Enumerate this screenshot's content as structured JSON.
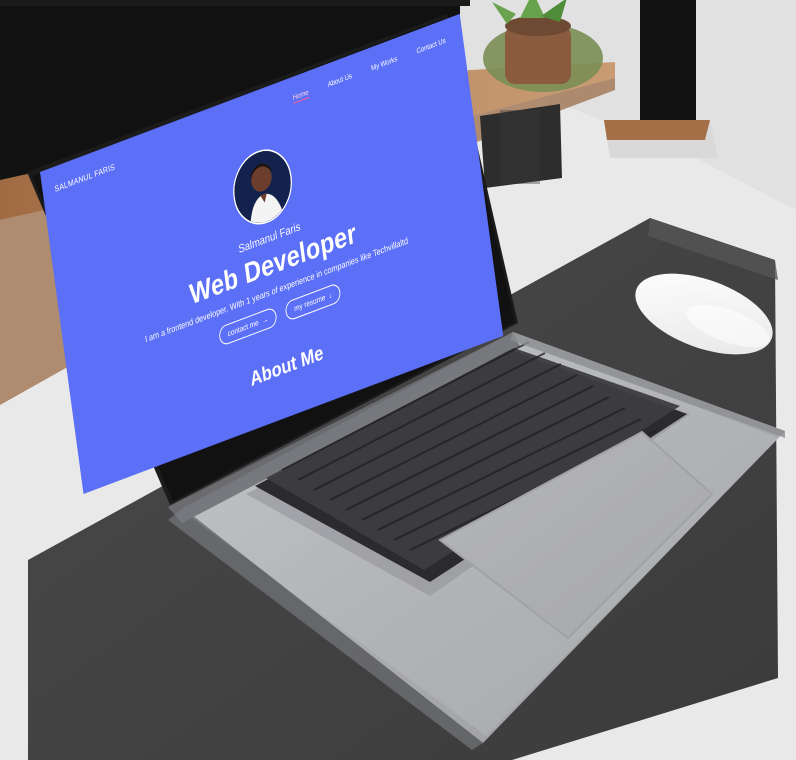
{
  "site": {
    "brand": "SALMANUL FARIS",
    "nav": [
      "Home",
      "About Us",
      "My Works",
      "Contact Us"
    ],
    "active": "Home"
  },
  "hero": {
    "name": "Salmanul Faris",
    "title": "Web Developer",
    "bio": "I am a frontend developer. With 1 years of experience in companies like Techvillaltd",
    "buttons": {
      "contact": "contact me",
      "resume": "my resume"
    }
  },
  "section": {
    "about_title": "About Me"
  },
  "colors": {
    "screen_bg": "#5b6ff7",
    "white": "#ffffff",
    "nav_active_underline": "#ff5f94",
    "desk_mat": "#454545",
    "laptop_body": "#a7a8ab"
  },
  "icons": {
    "contact_arrow": "→",
    "resume_arrow": "↓"
  }
}
